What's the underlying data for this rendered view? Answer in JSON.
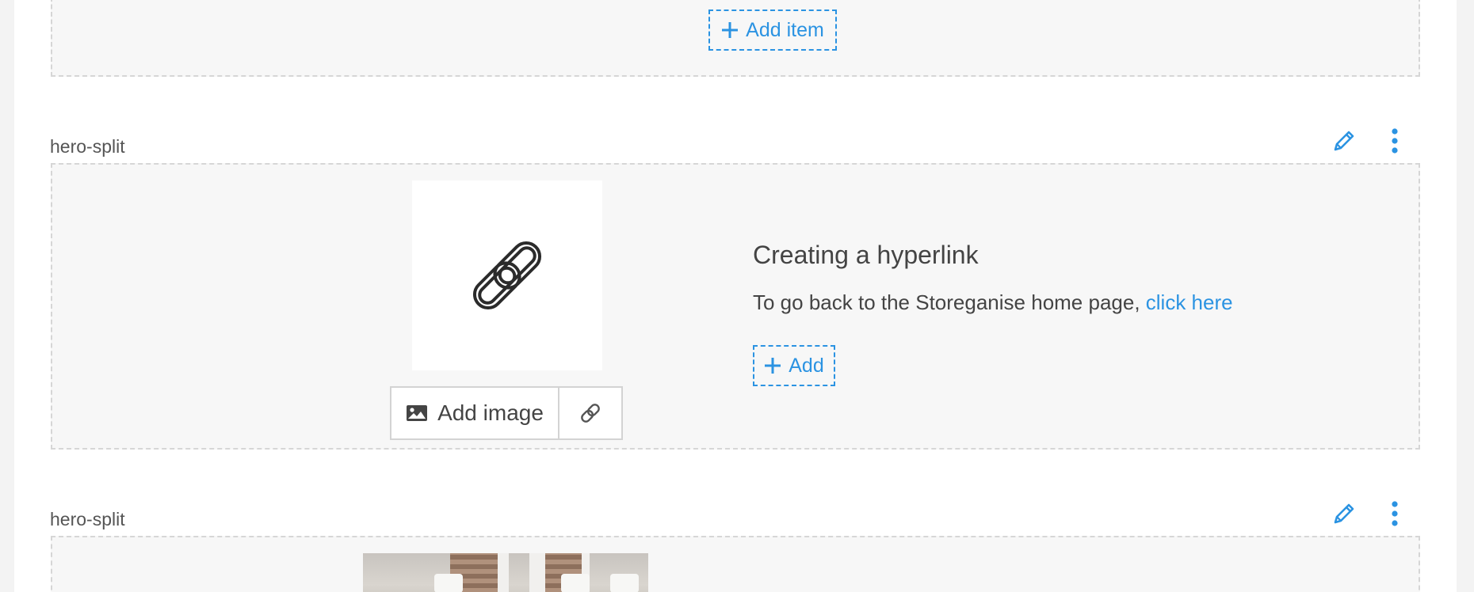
{
  "top_block": {
    "add_item_label": "Add item"
  },
  "sections": [
    {
      "label": "hero-split",
      "image_actions": {
        "add_image_label": "Add image"
      },
      "heading": "Creating a hyperlink",
      "body_prefix": "To go back to the Storeganise home page, ",
      "link_text": "click here",
      "add_label": "Add"
    },
    {
      "label": "hero-split"
    }
  ],
  "colors": {
    "accent": "#2b93e2",
    "text": "#444444",
    "block_background": "#f7f7f7",
    "block_border": "#d6d6d6"
  },
  "icons": {
    "add": "plus-icon",
    "edit": "pencil-icon",
    "more": "vertical-dots-icon",
    "placeholder": "chain-link-icon",
    "add_image": "picture-icon",
    "image_link": "link-icon"
  }
}
